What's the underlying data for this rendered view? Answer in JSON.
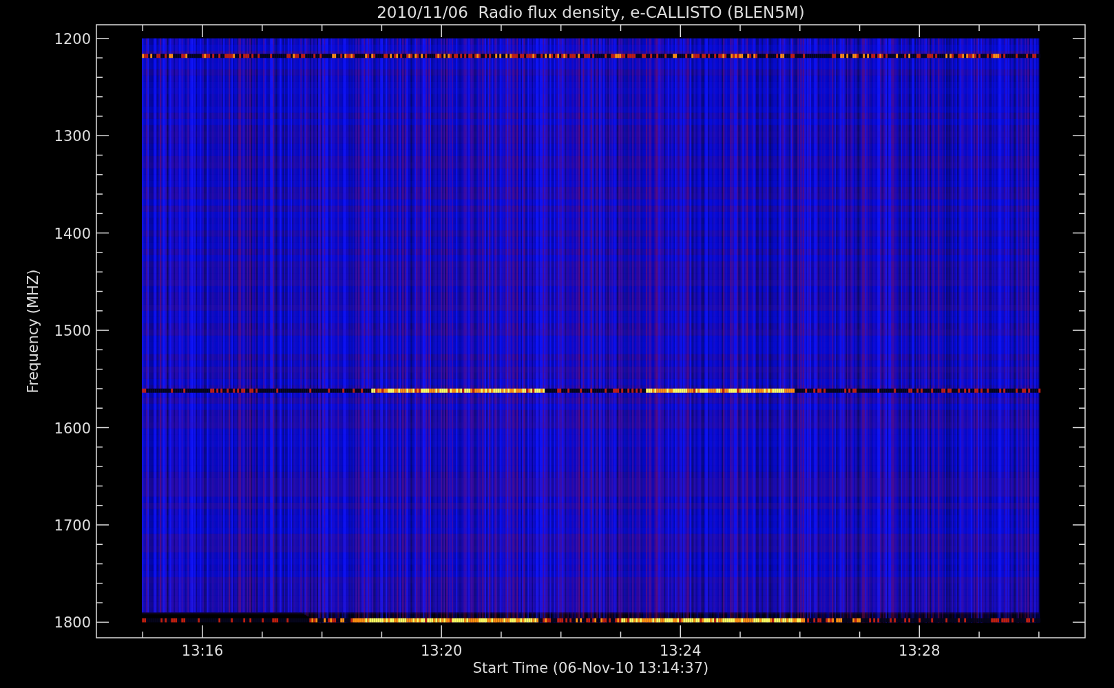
{
  "chart_data": {
    "type": "scatter",
    "title": "2010/11/06  Radio flux density, e-CALLISTO (BLEN5M)",
    "xlabel": "Start Time (06-Nov-10 13:14:37)",
    "ylabel": "Frequency (MHZ)",
    "categories": [
      null,
      "13:16",
      null,
      null,
      null,
      "13:20",
      null,
      null,
      null,
      "13:24",
      null,
      null,
      null,
      "13:28",
      null,
      null
    ],
    "ylim": [
      1816,
      1186
    ],
    "yticks": [
      1200,
      1300,
      1400,
      1500,
      1600,
      1700,
      1800
    ]
  }
}
